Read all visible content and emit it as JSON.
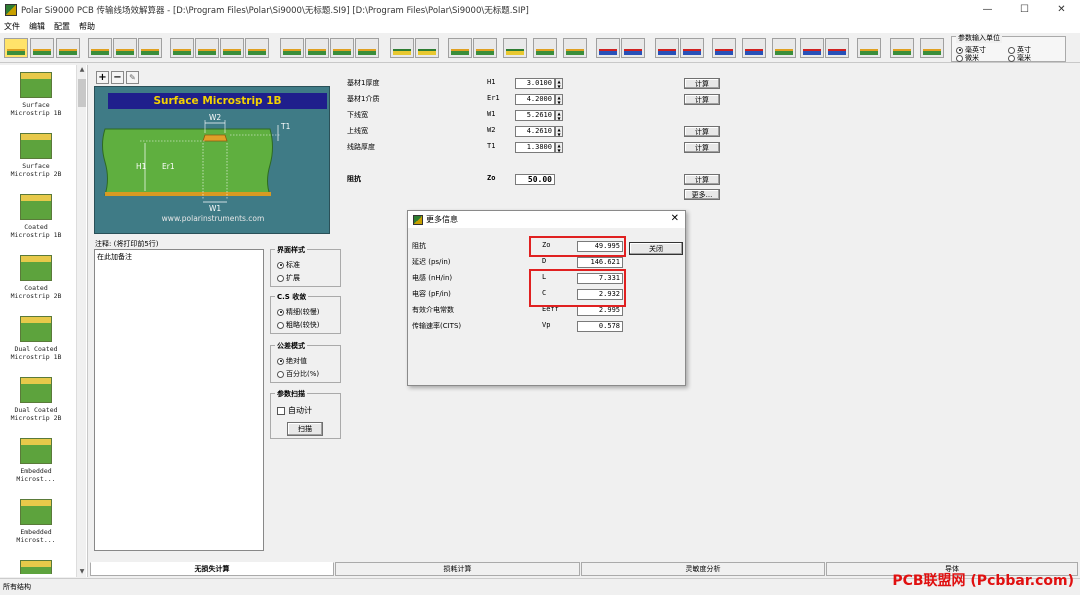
{
  "window": {
    "title": "Polar Si9000 PCB 传输线场效解算器 - [D:\\Program Files\\Polar\\Si9000\\无标题.SI9]  [D:\\Program Files\\Polar\\Si9000\\无标题.SIP]",
    "minimize": "—",
    "maximize": "☐",
    "close": "✕"
  },
  "menu": [
    "文件",
    "编辑",
    "配置",
    "帮助"
  ],
  "units": {
    "legend": "参数输入单位",
    "options": [
      "毫英寸",
      "英寸",
      "微米",
      "毫米"
    ],
    "selected": "毫英寸"
  },
  "gallery": [
    "Surface\nMicrostrip 1B",
    "Surface\nMicrostrip 2B",
    "Coated\nMicrostrip 1B",
    "Coated\nMicrostrip 2B",
    "Dual Coated\nMicrostrip 1B",
    "Dual Coated\nMicrostrip 2B",
    "Embedded\nMicrost...",
    "Embedded\nMicrost..."
  ],
  "diagram": {
    "title": "Surface Microstrip 1B",
    "labels": {
      "w2": "W2",
      "t1": "T1",
      "h1": "H1",
      "er1": "Er1",
      "w1": "W1"
    },
    "site": "www.polarinstruments.com"
  },
  "notes": {
    "label": "注释: (将打印前5行)",
    "text": "在此加备注"
  },
  "groups": {
    "interface": {
      "legend": "界面样式",
      "options": [
        "标准",
        "扩展"
      ],
      "selected": "标准"
    },
    "convergence": {
      "legend": "C.S 收敛",
      "options": [
        "精细(较慢)",
        "粗略(较快)"
      ],
      "selected": "精细(较慢)"
    },
    "tolerance": {
      "legend": "公差模式",
      "options": [
        "绝对值",
        "百分比(%)"
      ],
      "selected": "绝对值"
    },
    "scan": {
      "legend": "参数扫描",
      "checkbox": "自动计",
      "button": "扫描"
    }
  },
  "params": [
    {
      "label": "基材1厚度",
      "symbol": "H1",
      "value": "3.0100"
    },
    {
      "label": "基材1介质",
      "symbol": "Er1",
      "value": "4.2000"
    },
    {
      "label": "下线宽",
      "symbol": "W1",
      "value": "5.2610"
    },
    {
      "label": "上线宽",
      "symbol": "W2",
      "value": "4.2610"
    },
    {
      "label": "线路厚度",
      "symbol": "T1",
      "value": "1.3800"
    }
  ],
  "impedance": {
    "label": "阻抗",
    "symbol": "Zo",
    "value": "50.00"
  },
  "buttons": {
    "calc": "计算",
    "more": "更多..."
  },
  "dialog": {
    "title": "更多信息",
    "close_x": "✕",
    "close_button": "关闭",
    "rows": [
      {
        "label": "阻抗",
        "symbol": "Zo",
        "value": "49.995"
      },
      {
        "label": "延迟 (ps/in)",
        "symbol": "D",
        "value": "146.621"
      },
      {
        "label": "电感 (nH/in)",
        "symbol": "L",
        "value": "7.331"
      },
      {
        "label": "电容 (pF/in)",
        "symbol": "C",
        "value": "2.932"
      },
      {
        "label": "有效介电常数",
        "symbol": "Eeff",
        "value": "2.995"
      },
      {
        "label": "传输速率(CITS)",
        "symbol": "Vp",
        "value": "0.578"
      }
    ]
  },
  "tabs": [
    "无损失计算",
    "损耗计算",
    "灵敏度分析",
    "导体"
  ],
  "status": "所有结构",
  "watermark": "PCB联盟网 (Pcbbar.com)"
}
